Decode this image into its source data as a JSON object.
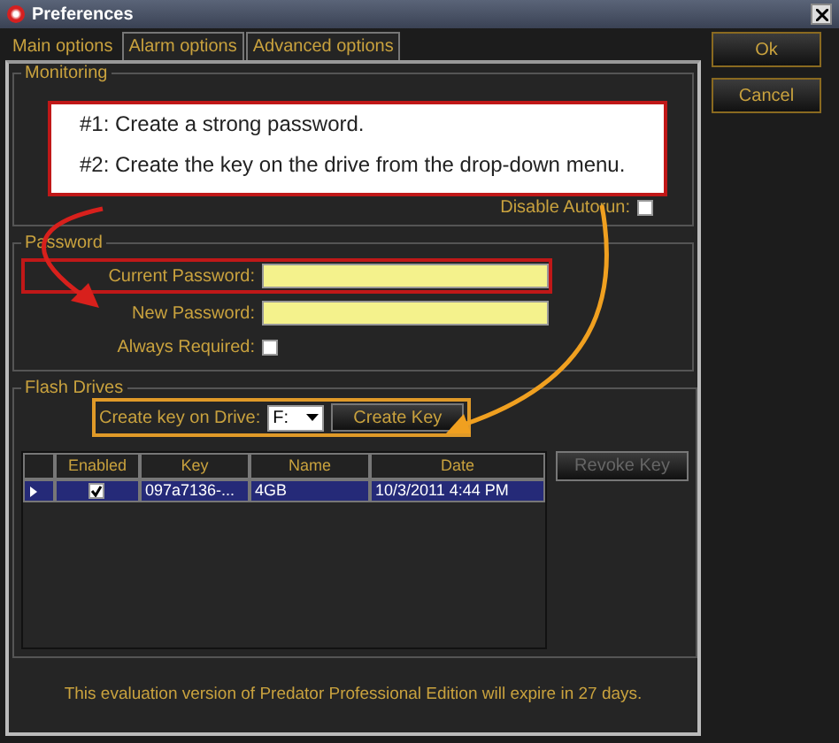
{
  "window": {
    "title": "Preferences"
  },
  "tabs": [
    {
      "label": "Main options",
      "selected": true
    },
    {
      "label": "Alarm options",
      "selected": false
    },
    {
      "label": "Advanced options",
      "selected": false
    }
  ],
  "buttons": [
    {
      "label": "Ok"
    },
    {
      "label": "Cancel"
    }
  ],
  "monitoring": {
    "title": "Monitoring",
    "disable_autorun": {
      "label": "Disable Autorun:",
      "checked": false
    }
  },
  "password": {
    "title": "Password",
    "fields": [
      {
        "label": "Current Password:",
        "highlighted": true
      },
      {
        "label": "New Password:",
        "highlighted": false
      }
    ],
    "always_required": {
      "label": "Always Required:",
      "checked": false
    }
  },
  "flash_drives": {
    "title": "Flash Drives",
    "highlighted": true,
    "drive_label": "Create key on Drive:",
    "drive": "F:",
    "create_button": "Create Key",
    "revoke_button": {
      "label": "Revoke Key",
      "disabled": true
    },
    "table": {
      "columns": [
        "Enabled",
        "Key",
        "Name",
        "Date"
      ],
      "rows": [
        {
          "selected": true,
          "enabled": true,
          "key": "097a7136-...",
          "name": "4GB",
          "date": "10/3/2011 4:44 PM"
        }
      ]
    }
  },
  "notice": "This evaluation version of Predator Professional Edition will expire in 27 days.",
  "callout": {
    "lines": [
      "#1: Create a strong password.",
      "#2: Create the key on the drive from the drop-down menu."
    ]
  }
}
